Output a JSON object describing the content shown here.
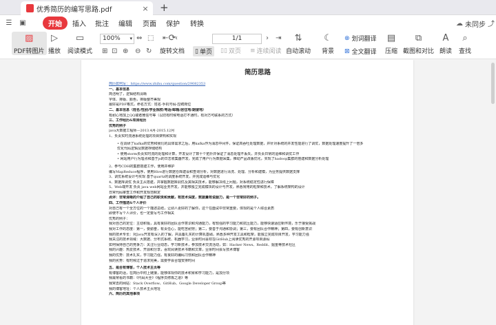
{
  "tab": {
    "title": "优秀简历的编写思路.pdf",
    "close": "×",
    "add": "+"
  },
  "menu": {
    "items": [
      "开始",
      "插入",
      "批注",
      "编辑",
      "页面",
      "保护",
      "转换"
    ],
    "sync": "未同步"
  },
  "toolbar": {
    "pdf_to_image": "PDF转图片",
    "play": "播放",
    "read_mode": "阅读模式",
    "zoom": "100%",
    "page_indicator": "1/1",
    "rotate": "旋转文档",
    "single": "单页",
    "double": "双页",
    "continuous": "连续阅读",
    "auto_scroll": "自动滚动",
    "background": "背景",
    "word_translate": "划词翻译",
    "full_translate": "全文翻译",
    "compress": "压缩",
    "screenshot_compare": "截图和对比",
    "read_aloud": "朗读",
    "find": "查找"
  },
  "document": {
    "title": "简历思路",
    "lines": [
      {
        "t": "简历如何写：                    https://www.zhihu.com/question/29082353",
        "c": "link"
      },
      {
        "t": "一、基本信息",
        "c": "b"
      },
      {
        "t": "简洁明了，逻辑结构清晰",
        "c": ""
      },
      {
        "t": "字体、排版、颜色，排版整齐美观",
        "c": ""
      },
      {
        "t": "最好是PDF格式，命名方式：姓名-手机号码-应聘岗位",
        "c": ""
      },
      {
        "t": "二、基本信息（姓名/性别/学业院校/电话/邮箱/居住地/期望地）",
        "c": "b"
      },
      {
        "t": "有耐心地加上QQ或者微信号等（以防有时候电话打不通时，有对方可联系的方式）",
        "c": ""
      },
      {
        "t": "三、工作经历&项目经历",
        "c": "b"
      },
      {
        "t": "优秀的例子",
        "c": "b"
      },
      {
        "t": "java大数据工程师—2013.4月-2015.12月",
        "c": ""
      },
      {
        "t": "1、负责实时流通系统处理的项目架构和实现",
        "c": ""
      },
      {
        "t": "",
        "c": "gap"
      },
      {
        "t": "• 在调研了kafka的优势和我们的具体需求之后，用kafka作为消息中间件，保证高吞吐处理数据，并针对系统的并发性能进行了调优，数据处理速度提升了一倍多",
        "c": "ind"
      },
      {
        "t": "  优化代码逻辑及数据存储结构",
        "c": "ind"
      },
      {
        "t": "• 使用storm负责实时流的处理和计算，开发设计了数十个拓扑并保证了消息处理不丢失，并负责日常的运维和调优工作",
        "c": "ind"
      },
      {
        "t": "• 网站用户行为埋点和基于js的日志收集器开发，完成了用户行为数据采集，推动产品改版优化，实现了hadoop集群的搭建和数据分析处理",
        "c": "ind"
      },
      {
        "t": "",
        "c": "gap"
      },
      {
        "t": "2、参与CDH的集群搭建工作，使用并维护",
        "c": ""
      },
      {
        "t": "编写MapReduce程序，使用Hive进行数据仓库建设和查询分析，对数据进行清洗、处理、分析和建模，为业务提供数据支撑",
        "c": ""
      },
      {
        "t": "3、调优系统设计与实现 基于quartz的调度系统开发，并完成运维与优化",
        "c": ""
      },
      {
        "t": "4、数据库调优 负责主从搭建，并掌握数据库调优及其相关技术，能够解决线上问题，对系统稳定性进行保障",
        "c": ""
      },
      {
        "t": "5、Web端开发 负责 java web网站业务开发，并能够独立完成模块的设计与开发，熟悉常用的框架和技术，了解系统架构的设计",
        "c": ""
      },
      {
        "t": "   日常代码审查工作和开发规范制定",
        "c": ""
      },
      {
        "t": "点评：非常清晰的介绍了自己的职责和贡献，有技术深度，数据量有说服力，是一个非常好的例子。",
        "c": "b"
      },
      {
        "t": "四、工作描述&个人评价",
        "c": "b"
      },
      {
        "t": "对自己有一个全方位的一个描述总结，让别人更好的了解你，这个在面试中非常重要，体现的是个人综合素质",
        "c": ""
      },
      {
        "t": "即使不写个人评价，也一定要写与工作相关",
        "c": ""
      },
      {
        "t": "优秀的例子：",
        "c": ""
      },
      {
        "t": "我对自己的定位：主动积极，具有良好的团队合作意识和沟通能力，有较强的学习能力和抗压能力，能够快速适应新环境，乐于接受挑战",
        "c": ""
      },
      {
        "t": "我对工作的态度：第一，要勤奋，有责任心，能吃苦耐劳；第二，要善于沟通和协调；第三，要有团队合作精神；第四，要有创新意识",
        "c": ""
      },
      {
        "t": "我的技术专长：对Java开发有深入的了解，并具备扎实的计算机基础，熟悉多种开发工具和框架，能独立完成项目开发，学习能力强",
        "c": ""
      },
      {
        "t": "我关注的技术领域：大数据、分布式系统、机器学习，业余时间喜欢在GitHub上阅读优秀的开源项目源码",
        "c": ""
      },
      {
        "t": "如何保持自己的竞争力：关注行业动态，学习新技术，参加技术交流活动，如：Hacker News、Reddit、掘金等技术社区",
        "c": ""
      },
      {
        "t": "我的兴趣：热爱技术、开源和分享，喜欢阅读技术书籍和文章，业余时间会写技术博客",
        "c": ""
      },
      {
        "t": "我的优势：技术扎实，学习能力强，有良好的编码习惯和团队合作精神",
        "c": ""
      },
      {
        "t": "我的劣势：有时候过于追求完美，需要学会合理安排时间",
        "c": ""
      },
      {
        "t": "",
        "c": "gap"
      },
      {
        "t": "五、是否有博客，个人技术主页等",
        "c": "b"
      },
      {
        "t": "有博客的话，在简历中附上链接，能够体现你的技术积累和学习能力，是加分项",
        "c": ""
      },
      {
        "t": "我最常看的书籍：《代码大全》《程序员修炼之道》等",
        "c": ""
      },
      {
        "t": "我常去的网站：Stack Overflow、GitHub、Google Developer Group等",
        "c": ""
      },
      {
        "t": "我的博客地址：个人技术主页地址",
        "c": ""
      },
      {
        "t": "六、简历的其他事项",
        "c": "b"
      }
    ]
  }
}
